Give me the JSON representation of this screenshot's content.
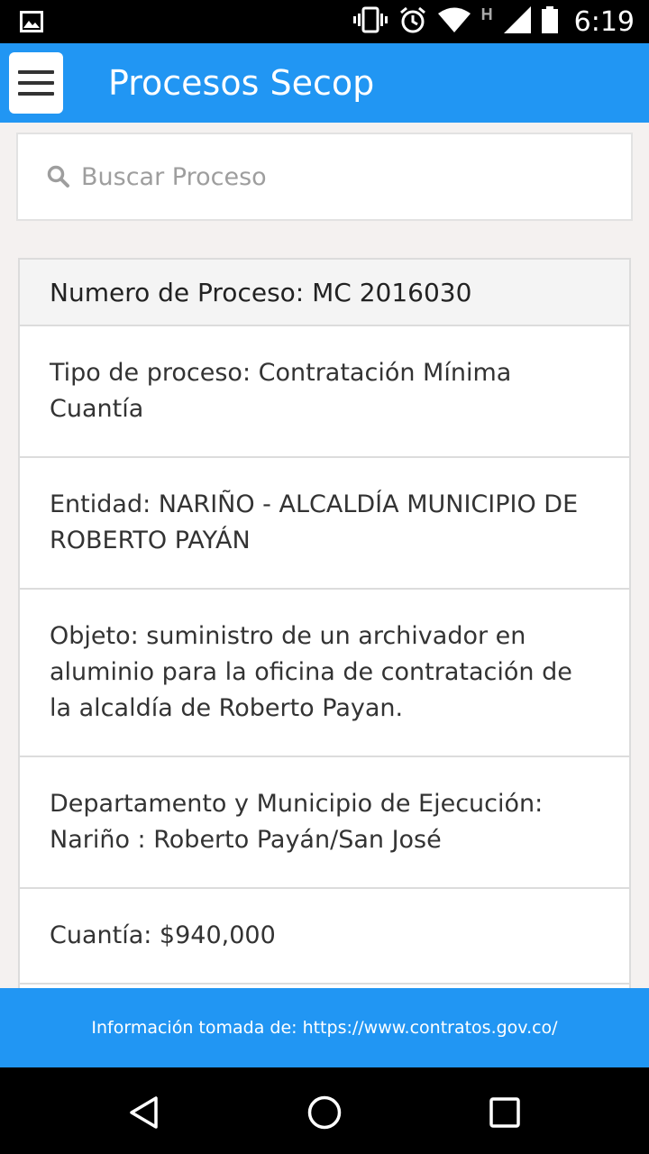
{
  "status_bar": {
    "time": "6:19",
    "network_label": "H",
    "icons": [
      "image-icon",
      "vibrate-icon",
      "alarm-icon",
      "wifi-icon",
      "signal-icon",
      "battery-icon"
    ]
  },
  "app_bar": {
    "title": "Procesos Secop",
    "menu_icon": "hamburger-menu-icon",
    "color": "#2196f3"
  },
  "search": {
    "placeholder": "Buscar Proceso",
    "value": "",
    "icon": "search-icon"
  },
  "process_card": {
    "header": "Numero de Proceso: MC 2016030",
    "fields": {
      "tipo": "Tipo de proceso: Contratación Mínima Cuantía",
      "entidad": "Entidad: NARIÑO - ALCALDÍA MUNICIPIO DE ROBERTO PAYÁN",
      "objeto": "Objeto: suministro de un archivador en aluminio para la oficina de contratación de la alcaldía de Roberto Payan.",
      "departamento": "Departamento y Municipio de Ejecución: Nariño : Roberto Payán/San José",
      "cuantia": "Cuantía: $940,000"
    }
  },
  "footer": {
    "text": "Información tomada de: https://www.contratos.gov.co/"
  },
  "nav_bar": {
    "icons": [
      "back-icon",
      "home-icon",
      "recents-icon"
    ]
  }
}
